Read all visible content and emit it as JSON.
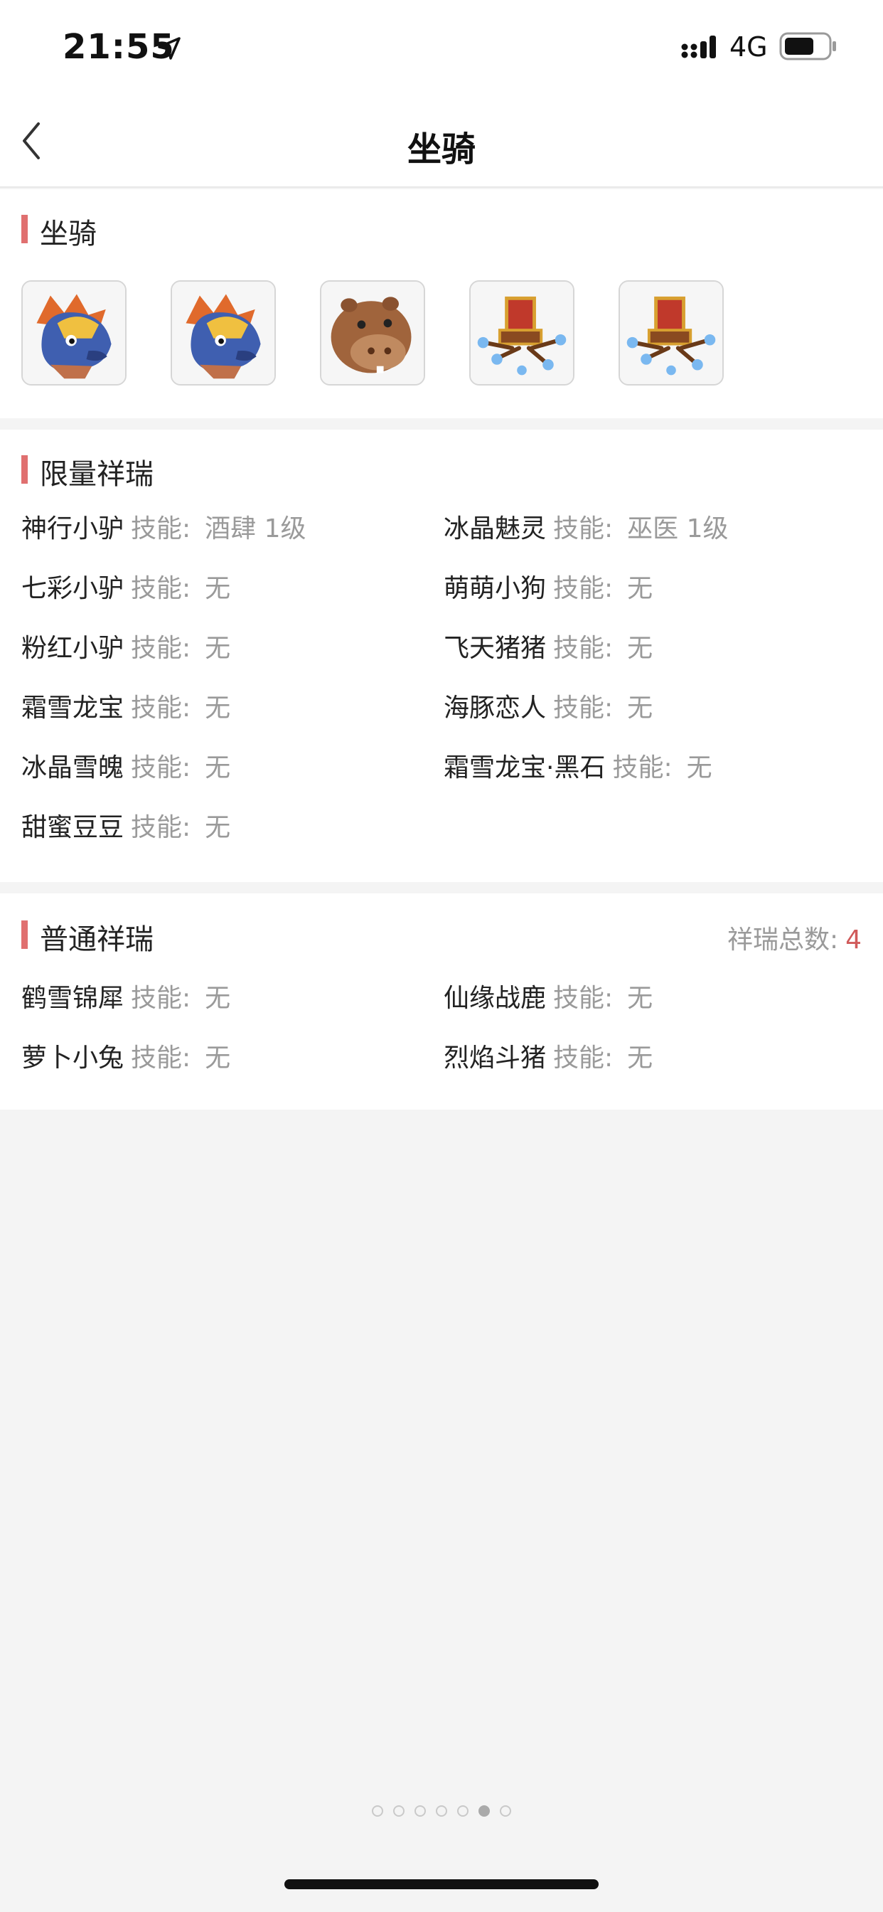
{
  "status_bar": {
    "time": "21:55",
    "network": "4G",
    "icons": [
      "location-arrow-icon",
      "signal-icon",
      "battery-icon"
    ]
  },
  "nav": {
    "title": "坐骑",
    "back_icon": "chevron-left-icon"
  },
  "mount_section": {
    "title": "坐骑",
    "mounts": [
      {
        "icon": "dragon-mount-icon"
      },
      {
        "icon": "dragon-mount-icon"
      },
      {
        "icon": "hippo-mount-icon"
      },
      {
        "icon": "throne-mount-icon"
      },
      {
        "icon": "throne-mount-icon"
      }
    ]
  },
  "limited_section": {
    "title": "限量祥瑞",
    "skill_label": "技能:",
    "items": [
      {
        "name": "神行小驴",
        "skill": "酒肆 1级"
      },
      {
        "name": "冰晶魅灵",
        "skill": "巫医 1级"
      },
      {
        "name": "七彩小驴",
        "skill": "无"
      },
      {
        "name": "萌萌小狗",
        "skill": "无"
      },
      {
        "name": "粉红小驴",
        "skill": "无"
      },
      {
        "name": "飞天猪猪",
        "skill": "无"
      },
      {
        "name": "霜雪龙宝",
        "skill": "无"
      },
      {
        "name": "海豚恋人",
        "skill": "无"
      },
      {
        "name": "冰晶雪魄",
        "skill": "无"
      },
      {
        "name": "霜雪龙宝·黑石",
        "skill": "无"
      },
      {
        "name": "甜蜜豆豆",
        "skill": "无"
      }
    ]
  },
  "normal_section": {
    "title": "普通祥瑞",
    "total_label": "祥瑞总数:",
    "total_value": "4",
    "skill_label": "技能:",
    "items": [
      {
        "name": "鹤雪锦犀",
        "skill": "无"
      },
      {
        "name": "仙缘战鹿",
        "skill": "无"
      },
      {
        "name": "萝卜小兔",
        "skill": "无"
      },
      {
        "name": "烈焰斗猪",
        "skill": "无"
      }
    ]
  },
  "pager": {
    "count": 7,
    "active_index": 5
  },
  "colors": {
    "accent": "#e07070",
    "total_number": "#d05a5a",
    "muted_text": "#9a9a9a",
    "page_background": "#f4f4f4"
  }
}
